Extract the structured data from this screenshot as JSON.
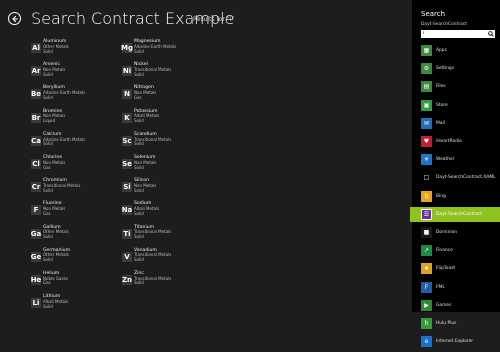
{
  "header": {
    "title": "Search Contract Example",
    "results_label": "Results for “i”"
  },
  "elements_col1": [
    {
      "symbol": "Al",
      "name": "Aluminum",
      "category": "Other Metals",
      "state": "Solid"
    },
    {
      "symbol": "Ar",
      "name": "Arsenic",
      "category": "Non Metals",
      "state": "Solid"
    },
    {
      "symbol": "Be",
      "name": "Beryllium",
      "category": "Alkaline Earth Metals",
      "state": "Solid"
    },
    {
      "symbol": "Br",
      "name": "Bromine",
      "category": "Non Metals",
      "state": "Liquid"
    },
    {
      "symbol": "Ca",
      "name": "Calcium",
      "category": "Alkaline Earth Metals",
      "state": "Solid"
    },
    {
      "symbol": "Cl",
      "name": "Chlorine",
      "category": "Non Metals",
      "state": "Gas"
    },
    {
      "symbol": "Cr",
      "name": "Chromium",
      "category": "Transitional Metals",
      "state": "Solid"
    },
    {
      "symbol": "F",
      "name": "Fluorine",
      "category": "Non Metals",
      "state": "Gas"
    },
    {
      "symbol": "Ga",
      "name": "Gallium",
      "category": "Other Metals",
      "state": "Solid"
    },
    {
      "symbol": "Ge",
      "name": "Germanium",
      "category": "Other Metals",
      "state": "Solid"
    },
    {
      "symbol": "He",
      "name": "Helium",
      "category": "Noble Gases",
      "state": "Gas"
    },
    {
      "symbol": "Li",
      "name": "Lithium",
      "category": "Alkali Metals",
      "state": "Solid"
    }
  ],
  "elements_col2": [
    {
      "symbol": "Mg",
      "name": "Magnesium",
      "category": "Alkaline Earth Metals",
      "state": "Solid"
    },
    {
      "symbol": "Ni",
      "name": "Nickel",
      "category": "Transitional Metals",
      "state": "Solid"
    },
    {
      "symbol": "N",
      "name": "Nitrogen",
      "category": "Non Metals",
      "state": "Gas"
    },
    {
      "symbol": "K",
      "name": "Potassium",
      "category": "Alkali Metals",
      "state": "Solid"
    },
    {
      "symbol": "Sc",
      "name": "Scandium",
      "category": "Transitional Metals",
      "state": "Solid"
    },
    {
      "symbol": "Se",
      "name": "Selenium",
      "category": "Non Metals",
      "state": "Solid"
    },
    {
      "symbol": "Si",
      "name": "Silicon",
      "category": "Non Metals",
      "state": "Solid"
    },
    {
      "symbol": "Na",
      "name": "Sodium",
      "category": "Alkali Metals",
      "state": "Solid"
    },
    {
      "symbol": "Ti",
      "name": "Titanium",
      "category": "Transitional Metals",
      "state": "Solid"
    },
    {
      "symbol": "V",
      "name": "Vanadium",
      "category": "Transitional Metals",
      "state": "Solid"
    },
    {
      "symbol": "Zn",
      "name": "Zinc",
      "category": "Transitional Metals",
      "state": "Solid"
    }
  ],
  "search_pane": {
    "title": "Search",
    "app_name": "Dayt-SearchContract",
    "query": "i",
    "apps": [
      {
        "label": "Apps",
        "color": "#3b8a3e",
        "glyph": "▦"
      },
      {
        "label": "Settings",
        "color": "#3b8a3e",
        "glyph": "⚙"
      },
      {
        "label": "Files",
        "color": "#3b8a3e",
        "glyph": "▤"
      },
      {
        "label": "Store",
        "color": "#2f9e44",
        "glyph": "▣"
      },
      {
        "label": "Mail",
        "color": "#1f6fb8",
        "glyph": "✉"
      },
      {
        "label": "iHeartRadio",
        "color": "#c21f2f",
        "glyph": "♥"
      },
      {
        "label": "Weather",
        "color": "#1e73c9",
        "glyph": "☀"
      },
      {
        "label": "Dayt-SearchContract.XAML",
        "color": "#000000",
        "glyph": "□"
      },
      {
        "label": "Bing",
        "color": "#e8a41a",
        "glyph": "b"
      },
      {
        "label": "Dayt-SearchContract",
        "color": "#6b2fa3",
        "glyph": "☰"
      },
      {
        "label": "Dominion",
        "color": "#1a1a1a",
        "glyph": "■"
      },
      {
        "label": "Finance",
        "color": "#1e8a3f",
        "glyph": "↗"
      },
      {
        "label": "FlipToast",
        "color": "#e0a020",
        "glyph": "★"
      },
      {
        "label": "FML",
        "color": "#1f5fa8",
        "glyph": "F"
      },
      {
        "label": "Games",
        "color": "#2e8b32",
        "glyph": "▶"
      },
      {
        "label": "Hulu Plus",
        "color": "#3a9a3a",
        "glyph": "h"
      },
      {
        "label": "Internet Explorer",
        "color": "#1a6fd0",
        "glyph": "e"
      }
    ],
    "selected_index": 9
  }
}
